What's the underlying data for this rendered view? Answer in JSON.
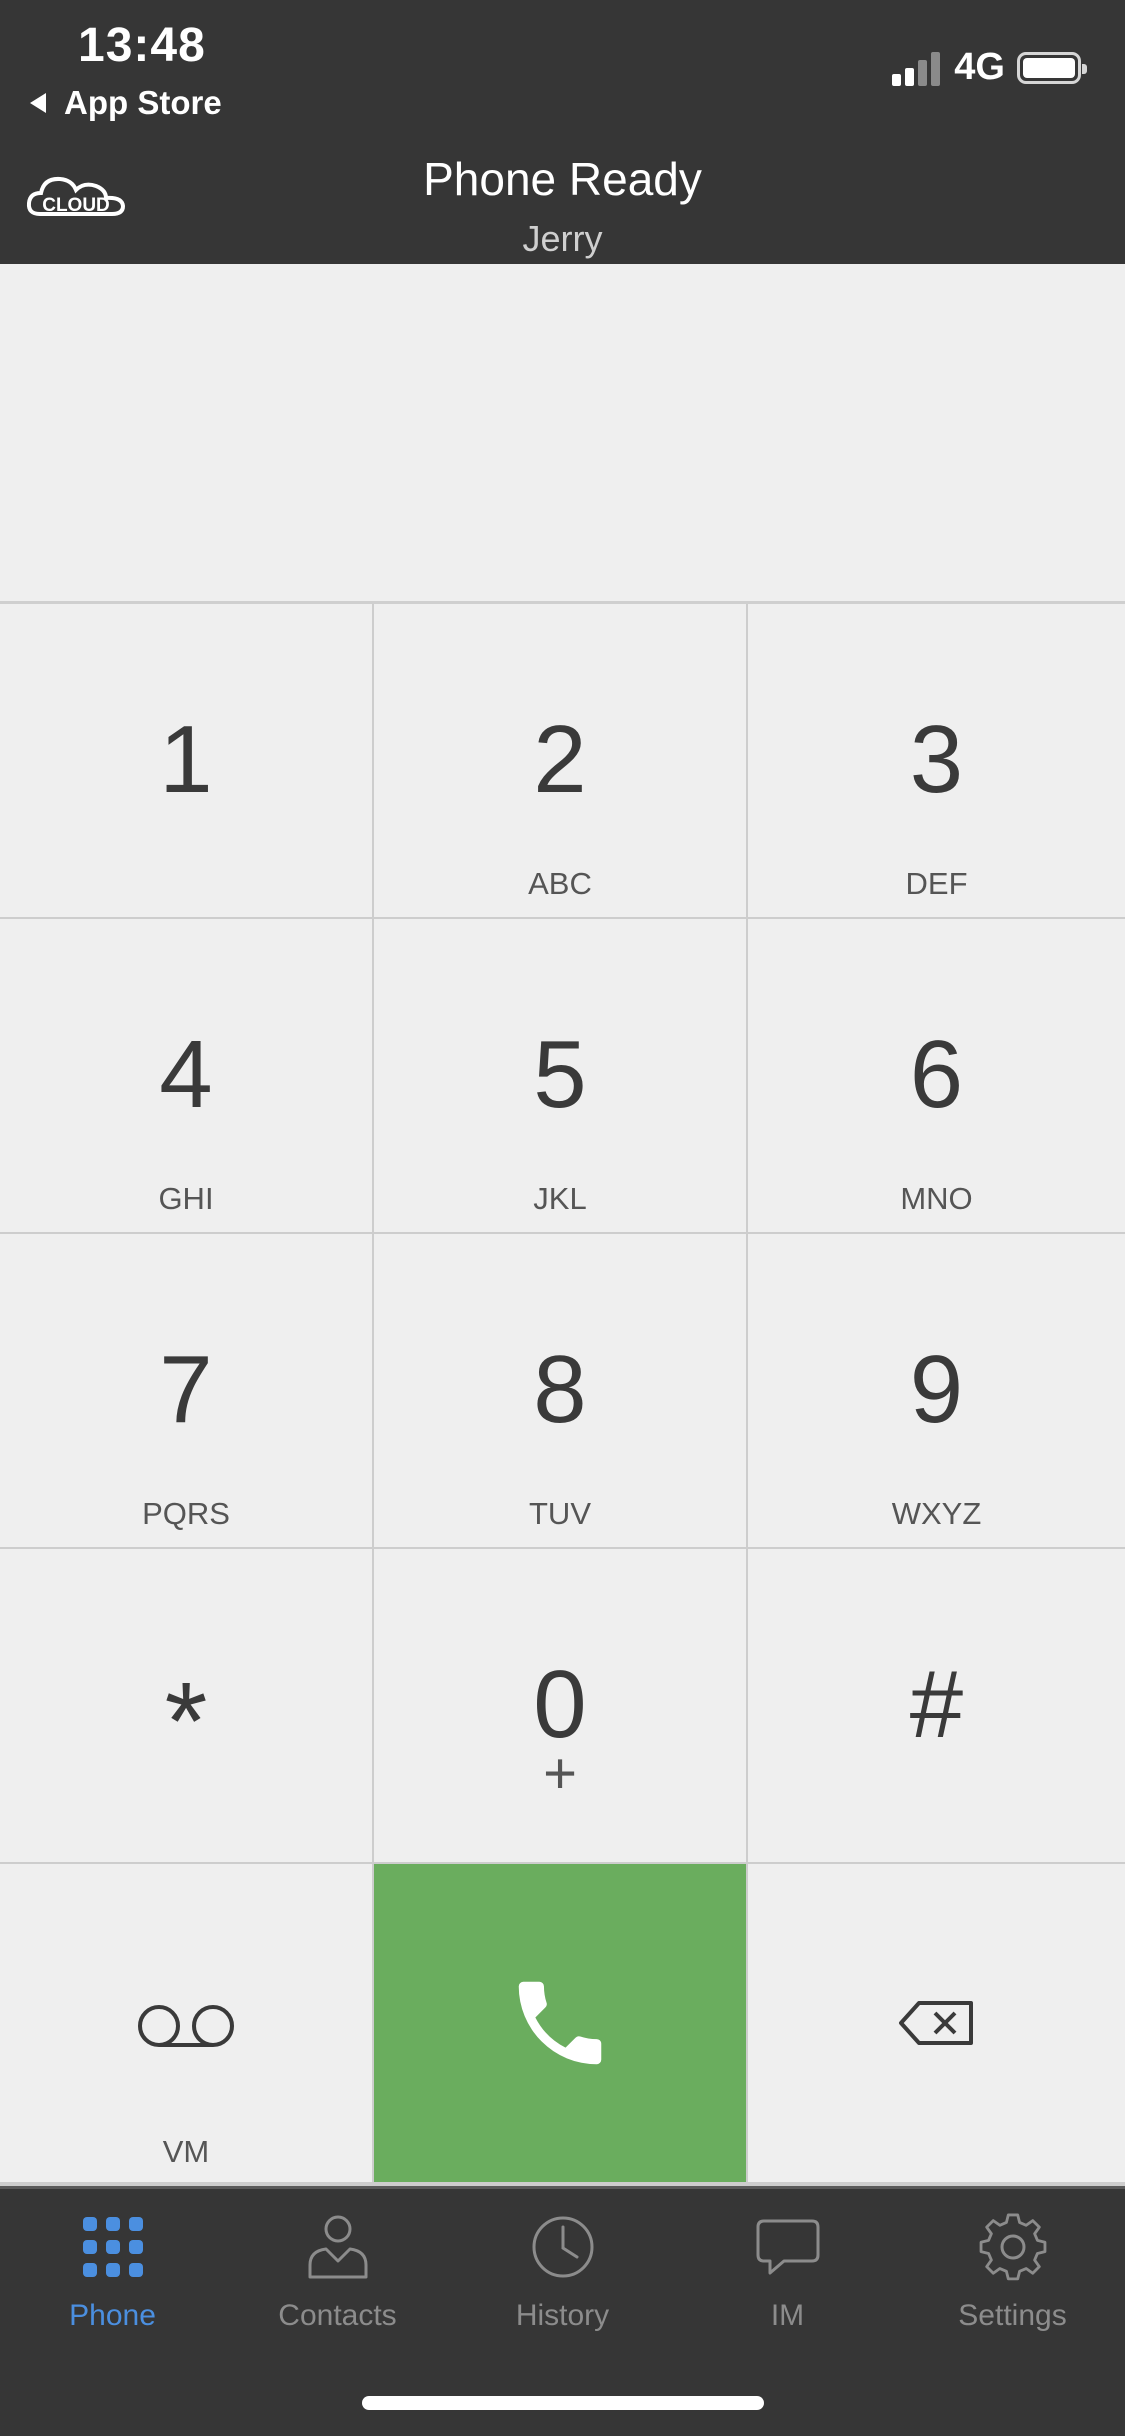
{
  "status_bar": {
    "time": "13:48",
    "back_app": "App Store",
    "network": "4G"
  },
  "header": {
    "logo_text": "CLOUD",
    "title": "Phone Ready",
    "subtitle": "Jerry"
  },
  "display": {
    "number": ""
  },
  "keypad": {
    "keys": [
      {
        "digit": "1",
        "letters": ""
      },
      {
        "digit": "2",
        "letters": "ABC"
      },
      {
        "digit": "3",
        "letters": "DEF"
      },
      {
        "digit": "4",
        "letters": "GHI"
      },
      {
        "digit": "5",
        "letters": "JKL"
      },
      {
        "digit": "6",
        "letters": "MNO"
      },
      {
        "digit": "7",
        "letters": "PQRS"
      },
      {
        "digit": "8",
        "letters": "TUV"
      },
      {
        "digit": "9",
        "letters": "WXYZ"
      },
      {
        "digit": "*",
        "letters": ""
      },
      {
        "digit": "0",
        "letters": "+"
      },
      {
        "digit": "#",
        "letters": ""
      }
    ],
    "voicemail_label": "VM",
    "call_color": "#6aad5e"
  },
  "tabbar": {
    "active_color": "#4b8fe0",
    "tabs": [
      {
        "label": "Phone",
        "icon": "dialpad-icon",
        "active": true
      },
      {
        "label": "Contacts",
        "icon": "contact-person-icon",
        "active": false
      },
      {
        "label": "History",
        "icon": "clock-icon",
        "active": false
      },
      {
        "label": "IM",
        "icon": "chat-bubble-icon",
        "active": false
      },
      {
        "label": "Settings",
        "icon": "gear-icon",
        "active": false
      }
    ]
  }
}
